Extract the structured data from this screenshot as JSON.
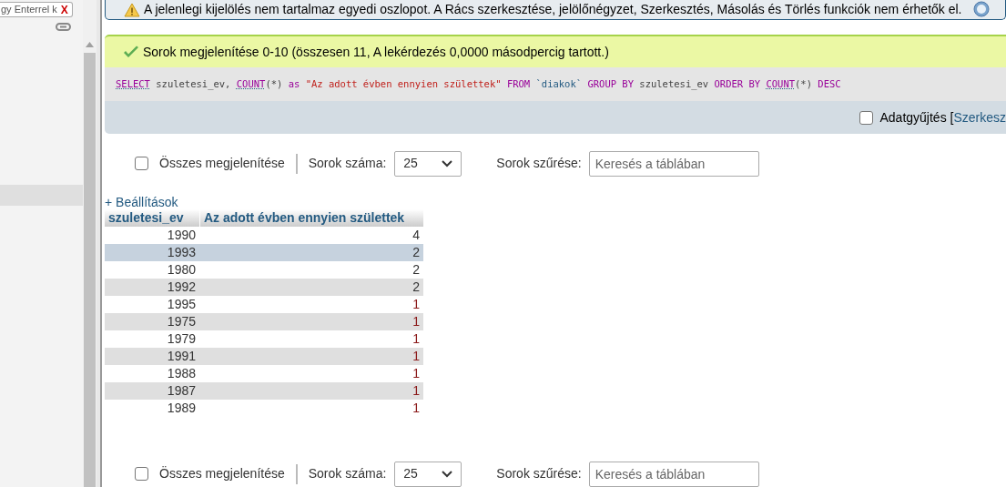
{
  "sidebar": {
    "tab": {
      "label": "gy Enterrel k",
      "close": "X"
    }
  },
  "notice": {
    "text": "A jelenlegi kijelölés nem tartalmaz egyedi oszlopot. A Rács szerkesztése, jelölőnégyzet, Szerkesztés, Másolás és Törlés funkciók nem érhetők el."
  },
  "success": {
    "text": "Sorok megjelenítése 0-10 (összesen 11, A lekérdezés 0,0000 másodpercig tartott.)"
  },
  "sql": [
    {
      "kind": "function",
      "text": "SELECT"
    },
    {
      "kind": "plain",
      "text": " szuletesi_ev, "
    },
    {
      "kind": "function",
      "text": "COUNT"
    },
    {
      "kind": "plain",
      "text": "(*) "
    },
    {
      "kind": "keyword",
      "text": "as "
    },
    {
      "kind": "string",
      "text": "\"Az adott évben ennyien születtek\" "
    },
    {
      "kind": "keyword",
      "text": "FROM "
    },
    {
      "kind": "identifier",
      "text": "`diakok` "
    },
    {
      "kind": "keyword",
      "text": "GROUP BY"
    },
    {
      "kind": "plain",
      "text": " szuletesi_ev "
    },
    {
      "kind": "keyword",
      "text": "ORDER BY "
    },
    {
      "kind": "function",
      "text": "COUNT"
    },
    {
      "kind": "plain",
      "text": "(*) "
    },
    {
      "kind": "keyword",
      "text": "DESC"
    }
  ],
  "profiling": {
    "checked": false,
    "label": "Adatgyűjtés [",
    "link": "Szerkesz"
  },
  "nav_top": {
    "show_all": {
      "checked": false,
      "label": "Összes megjelenítése"
    },
    "rows_label": "Sorok száma:",
    "rows_value": "25",
    "filter_label": "Sorok szűrése:",
    "filter_placeholder": "Keresés a táblában"
  },
  "options_link": "+ Beállítások",
  "table": {
    "columns": [
      "szuletesi_ev",
      "Az adott évben ennyien születtek"
    ],
    "rows": [
      {
        "cells": [
          "1990",
          "4"
        ],
        "selected": false,
        "color": "#333333"
      },
      {
        "cells": [
          "1993",
          "2"
        ],
        "selected": true,
        "color": "#333333"
      },
      {
        "cells": [
          "1980",
          "2"
        ],
        "selected": false,
        "color": "#333333"
      },
      {
        "cells": [
          "1992",
          "2"
        ],
        "selected": false,
        "color": "#333333"
      },
      {
        "cells": [
          "1995",
          "1"
        ],
        "selected": false,
        "color": "#8b1a1a"
      },
      {
        "cells": [
          "1975",
          "1"
        ],
        "selected": false,
        "color": "#8b1a1a"
      },
      {
        "cells": [
          "1979",
          "1"
        ],
        "selected": false,
        "color": "#8b1a1a"
      },
      {
        "cells": [
          "1991",
          "1"
        ],
        "selected": false,
        "color": "#8b1a1a"
      },
      {
        "cells": [
          "1988",
          "1"
        ],
        "selected": false,
        "color": "#8b1a1a"
      },
      {
        "cells": [
          "1987",
          "1"
        ],
        "selected": false,
        "color": "#8b1a1a"
      },
      {
        "cells": [
          "1989",
          "1"
        ],
        "selected": false,
        "color": "#8b1a1a"
      }
    ]
  },
  "nav_bottom": {
    "show_all": {
      "checked": false,
      "label": "Összes megjelenítése"
    },
    "rows_label": "Sorok száma:",
    "rows_value": "25",
    "filter_label": "Sorok szűrése:",
    "filter_placeholder": "Keresés a táblában"
  }
}
